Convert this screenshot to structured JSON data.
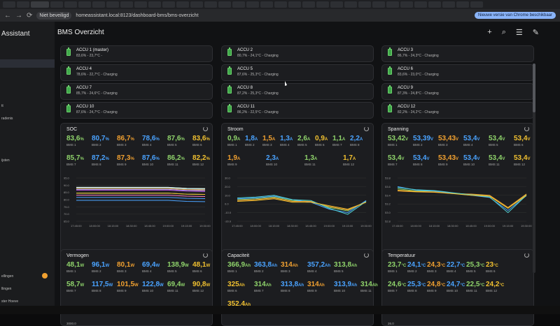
{
  "browser": {
    "security_label": "Niet beveiligd",
    "url": "homeassistant.local:8123/dashboard-bms/bms-overzicht",
    "chrome_button": "Nieuwe versie van Chrome beschikbaar"
  },
  "sidebar": {
    "brand": "Assistant",
    "items": [
      "tt",
      "radenis",
      "ijsten",
      "ellingen",
      "llingen",
      "ster Hoeve"
    ]
  },
  "header": {
    "title": "BMS Overzicht"
  },
  "accus": [
    {
      "name": "ACCU 1 (master)",
      "info": "83,6% - 23,7°C -"
    },
    {
      "name": "ACCU 2",
      "info": "80,7% - 24,1°C - Charging"
    },
    {
      "name": "ACCU 3",
      "info": "86,7% - 24,3°C - Charging"
    },
    {
      "name": "ACCU 4",
      "info": "78,6% - 22,7°C - Charging"
    },
    {
      "name": "ACCU 5",
      "info": "87,6% - 25,3°C - Charging"
    },
    {
      "name": "ACCU 6",
      "info": "83,6% - 23,0°C - Charging"
    },
    {
      "name": "ACCU 7",
      "info": "85,7% - 24,6°C - Charging"
    },
    {
      "name": "ACCU 8",
      "info": "87,2% - 25,3°C - Charging"
    },
    {
      "name": "ACCU 9",
      "info": "87,3% - 24,8°C - Charging"
    },
    {
      "name": "ACCU 10",
      "info": "87,6% - 24,7°C - Charging"
    },
    {
      "name": "ACCU 11",
      "info": "86,2% - 22,5°C - Charging"
    },
    {
      "name": "ACCU 12",
      "info": "82,2% - 24,2°C - Charging"
    }
  ],
  "soc": {
    "title": "SOC",
    "row1": [
      {
        "v": "83,6",
        "u": "%",
        "l": "BMS 1",
        "c": "#8fd36b"
      },
      {
        "v": "80,7",
        "u": "%",
        "l": "BMS 2",
        "c": "#4aa3ff"
      },
      {
        "v": "86,7",
        "u": "%",
        "l": "BMS 3",
        "c": "#f0a030"
      },
      {
        "v": "78,6",
        "u": "%",
        "l": "BMS 4",
        "c": "#4aa3ff"
      },
      {
        "v": "87,6",
        "u": "%",
        "l": "BMS 5",
        "c": "#8fd36b"
      },
      {
        "v": "83,6",
        "u": "%",
        "l": "BMS 6",
        "c": "#f0c030"
      }
    ],
    "row2": [
      {
        "v": "85,7",
        "u": "%",
        "l": "BMS 7",
        "c": "#8fd36b"
      },
      {
        "v": "87,2",
        "u": "%",
        "l": "BMS 8",
        "c": "#4aa3ff"
      },
      {
        "v": "87,3",
        "u": "%",
        "l": "BMS 9",
        "c": "#f0a030"
      },
      {
        "v": "87,6",
        "u": "%",
        "l": "BMS 10",
        "c": "#4aa3ff"
      },
      {
        "v": "86,2",
        "u": "%",
        "l": "BMS 11",
        "c": "#8fd36b"
      },
      {
        "v": "82,2",
        "u": "%",
        "l": "BMS 12",
        "c": "#f0c030"
      }
    ]
  },
  "stroom": {
    "title": "Stroom",
    "row1": [
      {
        "v": "0,9",
        "u": "A",
        "l": "BMS 1",
        "c": "#8fd36b"
      },
      {
        "v": "1,8",
        "u": "A",
        "l": "BMS 2",
        "c": "#4aa3ff"
      },
      {
        "v": "1,5",
        "u": "A",
        "l": "BMS 3",
        "c": "#f0a030"
      },
      {
        "v": "1,3",
        "u": "A",
        "l": "BMS 4",
        "c": "#4aa3ff"
      },
      {
        "v": "2,6",
        "u": "A",
        "l": "BMS 5",
        "c": "#8fd36b"
      },
      {
        "v": "0,9",
        "u": "A",
        "l": "BMS 6",
        "c": "#f0c030"
      },
      {
        "v": "1,1",
        "u": "A",
        "l": "BMS 7",
        "c": "#8fd36b"
      },
      {
        "v": "2,2",
        "u": "A",
        "l": "BMS 8",
        "c": "#4aa3ff"
      }
    ],
    "row2": [
      {
        "v": "1,9",
        "u": "A",
        "l": "BMS 9",
        "c": "#f0a030"
      },
      {
        "v": "2,3",
        "u": "A",
        "l": "BMS 10",
        "c": "#4aa3ff"
      },
      {
        "v": "1,3",
        "u": "A",
        "l": "BMS 11",
        "c": "#8fd36b"
      },
      {
        "v": "1,7",
        "u": "A",
        "l": "BMS 12",
        "c": "#f0c030"
      }
    ]
  },
  "spanning": {
    "title": "Spanning",
    "row1": [
      {
        "v": "53,42",
        "u": "V",
        "l": "BMS 1",
        "c": "#8fd36b"
      },
      {
        "v": "53,39",
        "u": "V",
        "l": "BMS 2",
        "c": "#4aa3ff"
      },
      {
        "v": "53,43",
        "u": "V",
        "l": "BMS 3",
        "c": "#f0a030"
      },
      {
        "v": "53,4",
        "u": "V",
        "l": "BMS 4",
        "c": "#4aa3ff"
      },
      {
        "v": "53,4",
        "u": "V",
        "l": "BMS 5",
        "c": "#8fd36b"
      },
      {
        "v": "53,4",
        "u": "V",
        "l": "BMS 6",
        "c": "#f0c030"
      }
    ],
    "row2": [
      {
        "v": "53,4",
        "u": "V",
        "l": "BMS 7",
        "c": "#8fd36b"
      },
      {
        "v": "53,4",
        "u": "V",
        "l": "BMS 8",
        "c": "#4aa3ff"
      },
      {
        "v": "53,43",
        "u": "V",
        "l": "BMS 9",
        "c": "#f0a030"
      },
      {
        "v": "53,4",
        "u": "V",
        "l": "BMS 10",
        "c": "#4aa3ff"
      },
      {
        "v": "53,4",
        "u": "V",
        "l": "BMS 11",
        "c": "#8fd36b"
      },
      {
        "v": "53,4",
        "u": "V",
        "l": "BMS 12",
        "c": "#f0c030"
      }
    ]
  },
  "vermogen": {
    "title": "Vermogen",
    "row1": [
      {
        "v": "48,1",
        "u": "W",
        "l": "BMS 1",
        "c": "#8fd36b"
      },
      {
        "v": "96,1",
        "u": "W",
        "l": "BMS 2",
        "c": "#4aa3ff"
      },
      {
        "v": "80,1",
        "u": "W",
        "l": "BMS 3",
        "c": "#f0a030"
      },
      {
        "v": "69,4",
        "u": "W",
        "l": "BMS 4",
        "c": "#4aa3ff"
      },
      {
        "v": "138,9",
        "u": "W",
        "l": "BMS 5",
        "c": "#8fd36b"
      },
      {
        "v": "48,1",
        "u": "W",
        "l": "BMS 6",
        "c": "#f0c030"
      }
    ],
    "row2": [
      {
        "v": "58,7",
        "u": "W",
        "l": "BMS 7",
        "c": "#8fd36b"
      },
      {
        "v": "117,5",
        "u": "W",
        "l": "BMS 8",
        "c": "#4aa3ff"
      },
      {
        "v": "101,5",
        "u": "W",
        "l": "BMS 9",
        "c": "#f0a030"
      },
      {
        "v": "122,8",
        "u": "W",
        "l": "BMS 10",
        "c": "#4aa3ff"
      },
      {
        "v": "69,4",
        "u": "W",
        "l": "BMS 11",
        "c": "#8fd36b"
      },
      {
        "v": "90,8",
        "u": "W",
        "l": "BMS 12",
        "c": "#f0c030"
      }
    ],
    "axis_top": "3000.0"
  },
  "capaciteit": {
    "title": "Capaciteit",
    "row1": [
      {
        "v": "366,9",
        "u": "Ah",
        "l": "BMS 1",
        "c": "#8fd36b"
      },
      {
        "v": "363,8",
        "u": "Ah",
        "l": "BMS 2",
        "c": "#4aa3ff"
      },
      {
        "v": "314",
        "u": "Ah",
        "l": "BMS 3",
        "c": "#f0a030"
      },
      {
        "v": "357,2",
        "u": "Ah",
        "l": "BMS 4",
        "c": "#4aa3ff"
      },
      {
        "v": "313,8",
        "u": "Ah",
        "l": "BMS 5",
        "c": "#8fd36b"
      }
    ],
    "row2": [
      {
        "v": "325",
        "u": "Ah",
        "l": "BMS 6",
        "c": "#f0c030"
      },
      {
        "v": "314",
        "u": "Ah",
        "l": "BMS 7",
        "c": "#8fd36b"
      },
      {
        "v": "313,8",
        "u": "Ah",
        "l": "BMS 8",
        "c": "#4aa3ff"
      },
      {
        "v": "314",
        "u": "Ah",
        "l": "BMS 9",
        "c": "#f0a030"
      },
      {
        "v": "313,9",
        "u": "Ah",
        "l": "BMS 10",
        "c": "#4aa3ff"
      },
      {
        "v": "314",
        "u": "Ah",
        "l": "BMS 11",
        "c": "#8fd36b"
      }
    ],
    "row3": [
      {
        "v": "352,4",
        "u": "Ah",
        "l": "",
        "c": "#f0c030"
      }
    ]
  },
  "temperatuur": {
    "title": "Temperatuur",
    "row1": [
      {
        "v": "23,7",
        "u": "°C",
        "l": "BMS 1",
        "c": "#8fd36b"
      },
      {
        "v": "24,1",
        "u": "°C",
        "l": "BMS 2",
        "c": "#4aa3ff"
      },
      {
        "v": "24,3",
        "u": "°C",
        "l": "BMS 3",
        "c": "#f0a030"
      },
      {
        "v": "22,7",
        "u": "°C",
        "l": "BMS 4",
        "c": "#4aa3ff"
      },
      {
        "v": "25,3",
        "u": "°C",
        "l": "BMS 5",
        "c": "#8fd36b"
      },
      {
        "v": "23",
        "u": "°C",
        "l": "BMS 6",
        "c": "#f0c030"
      }
    ],
    "row2": [
      {
        "v": "24,6",
        "u": "°C",
        "l": "BMS 7",
        "c": "#8fd36b"
      },
      {
        "v": "25,3",
        "u": "°C",
        "l": "BMS 8",
        "c": "#4aa3ff"
      },
      {
        "v": "24,8",
        "u": "°C",
        "l": "BMS 9",
        "c": "#f0a030"
      },
      {
        "v": "24,7",
        "u": "°C",
        "l": "BMS 10",
        "c": "#4aa3ff"
      },
      {
        "v": "22,5",
        "u": "°C",
        "l": "BMS 11",
        "c": "#8fd36b"
      },
      {
        "v": "24,2",
        "u": "°C",
        "l": "BMS 12",
        "c": "#f0c030"
      }
    ],
    "axis_top": "26.0"
  },
  "chart_data": [
    {
      "type": "line",
      "title": "SOC",
      "x": [
        "17:45:00",
        "18:00:00",
        "18:15:00",
        "18:30:00",
        "18:45:00",
        "19:00:00",
        "19:15:00",
        "19:30:00"
      ],
      "yticks": [
        "65.0",
        "70.0",
        "75.0",
        "80.0",
        "85.0",
        "90.0",
        "95.0"
      ],
      "ylim": [
        65,
        95
      ],
      "series": [
        {
          "color": "#8fd36b",
          "values": [
            84.5,
            84.5,
            84.5,
            84.5,
            84.5,
            84.5,
            83.8,
            83.6
          ]
        },
        {
          "color": "#4aa3ff",
          "values": [
            81.6,
            81.6,
            81.6,
            81.6,
            81.6,
            81.6,
            80.9,
            80.7
          ]
        },
        {
          "color": "#f0a030",
          "values": [
            87.6,
            87.6,
            87.6,
            87.6,
            87.6,
            87.6,
            86.9,
            86.7
          ]
        },
        {
          "color": "#4aa3ff",
          "values": [
            79.5,
            79.5,
            79.5,
            79.5,
            79.5,
            79.5,
            78.8,
            78.6
          ]
        },
        {
          "color": "#8fd36b",
          "values": [
            88.5,
            88.5,
            88.5,
            88.5,
            88.5,
            88.5,
            87.8,
            87.6
          ]
        },
        {
          "color": "#f0c030",
          "values": [
            84.5,
            84.5,
            84.5,
            84.5,
            84.5,
            84.5,
            83.8,
            83.6
          ]
        },
        {
          "color": "#c050e0",
          "values": [
            86.6,
            86.6,
            86.6,
            86.6,
            86.6,
            86.6,
            85.9,
            85.7
          ]
        },
        {
          "color": "#e05050",
          "values": [
            88.1,
            88.1,
            88.1,
            88.1,
            88.1,
            88.1,
            87.4,
            87.2
          ]
        },
        {
          "color": "#50d0d0",
          "values": [
            88.2,
            88.2,
            88.2,
            88.2,
            88.2,
            88.2,
            87.5,
            87.3
          ]
        },
        {
          "color": "#ffffff",
          "values": [
            88.5,
            88.5,
            88.5,
            88.5,
            88.5,
            88.5,
            87.8,
            87.6
          ]
        },
        {
          "color": "#a0a0ff",
          "values": [
            87.1,
            87.1,
            87.1,
            87.1,
            87.1,
            87.1,
            86.4,
            86.2
          ]
        },
        {
          "color": "#ff80c0",
          "values": [
            83.1,
            83.1,
            83.1,
            83.1,
            83.1,
            83.1,
            82.4,
            82.2
          ]
        }
      ]
    },
    {
      "type": "line",
      "title": "Stroom",
      "x": [
        "17:45:00",
        "18:00:00",
        "18:15:00",
        "18:30:00",
        "18:45:00",
        "19:00:00",
        "19:15:00",
        "19:30:00"
      ],
      "yticks": [
        "-20.0",
        "-10.0",
        "0.0",
        "10.0",
        "20.0",
        "30.0"
      ],
      "ylim": [
        -20,
        30
      ],
      "series": [
        {
          "color": "#8fd36b",
          "values": [
            5,
            6,
            8,
            4,
            3,
            -4,
            -8,
            3
          ]
        },
        {
          "color": "#4aa3ff",
          "values": [
            6,
            7,
            9,
            5,
            2,
            -6,
            -10,
            4
          ]
        },
        {
          "color": "#f0a030",
          "values": [
            4,
            5,
            7,
            3,
            3,
            -3,
            -7,
            2
          ]
        },
        {
          "color": "#50d0d0",
          "values": [
            7,
            8,
            10,
            5,
            4,
            -5,
            -12,
            3
          ]
        },
        {
          "color": "#f0c030",
          "values": [
            3,
            4,
            6,
            2,
            2,
            -2,
            -6,
            2
          ]
        }
      ]
    },
    {
      "type": "line",
      "title": "Spanning",
      "x": [
        "17:45:00",
        "18:00:00",
        "18:15:00",
        "18:30:00",
        "18:45:00",
        "19:00:00",
        "19:15:00",
        "19:30:00"
      ],
      "yticks": [
        "52.8",
        "53.0",
        "53.2",
        "53.4",
        "53.6",
        "53.8"
      ],
      "ylim": [
        52.8,
        53.8
      ],
      "series": [
        {
          "color": "#8fd36b",
          "values": [
            53.55,
            53.5,
            53.5,
            53.45,
            53.42,
            53.38,
            53.1,
            53.42
          ]
        },
        {
          "color": "#4aa3ff",
          "values": [
            53.6,
            53.52,
            53.5,
            53.45,
            53.4,
            53.35,
            53.05,
            53.39
          ]
        },
        {
          "color": "#f0a030",
          "values": [
            53.5,
            53.48,
            53.47,
            53.44,
            53.43,
            53.4,
            53.12,
            53.43
          ]
        },
        {
          "color": "#50d0d0",
          "values": [
            53.58,
            53.53,
            53.51,
            53.46,
            53.41,
            53.36,
            53.0,
            53.4
          ]
        },
        {
          "color": "#f0c030",
          "values": [
            53.52,
            53.49,
            53.48,
            53.44,
            53.4,
            53.38,
            53.1,
            53.4
          ]
        }
      ]
    }
  ]
}
